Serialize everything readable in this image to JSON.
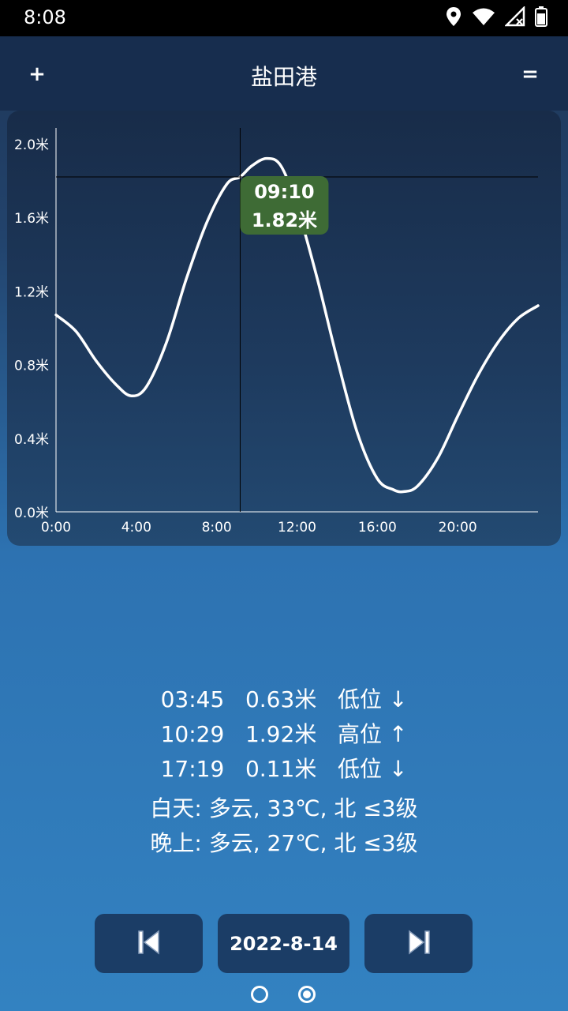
{
  "status_bar": {
    "time": "8:08",
    "icons": [
      "location-icon",
      "wifi-icon",
      "signal-off-icon",
      "battery-icon"
    ]
  },
  "app_bar": {
    "title": "盐田港",
    "add_label": "+",
    "menu_label": "="
  },
  "chart_data": {
    "type": "line",
    "x_tick_labels": [
      "0:00",
      "4:00",
      "8:00",
      "12:00",
      "16:00",
      "20:00"
    ],
    "y_tick_labels": [
      "0.0米",
      "0.4米",
      "0.8米",
      "1.2米",
      "1.6米",
      "2.0米"
    ],
    "xlim": [
      0,
      24
    ],
    "ylim": [
      0,
      2.0
    ],
    "x": [
      0,
      1,
      2,
      3,
      3.75,
      4.5,
      5.5,
      6.5,
      7.5,
      8.5,
      9.17,
      9.75,
      10.48,
      11.2,
      12,
      13,
      14,
      15,
      16,
      16.8,
      17.32,
      18,
      19,
      20,
      21,
      22,
      23,
      24
    ],
    "values": [
      1.07,
      0.98,
      0.82,
      0.69,
      0.63,
      0.68,
      0.92,
      1.27,
      1.57,
      1.78,
      1.82,
      1.88,
      1.92,
      1.88,
      1.66,
      1.27,
      0.83,
      0.43,
      0.18,
      0.12,
      0.11,
      0.14,
      0.29,
      0.52,
      0.74,
      0.92,
      1.05,
      1.12
    ],
    "crosshair": {
      "time": "09:10",
      "x": 9.17,
      "y": 1.82,
      "value_label": "1.82米"
    },
    "colors": {
      "line": "#ffffff",
      "tooltip": "#3e6b35",
      "highlight": "#7fd23a",
      "axis": "#ffffff",
      "crosshair": "#000000"
    },
    "grid": false
  },
  "tides": [
    {
      "time": "03:45",
      "height": "0.63米",
      "type": "低位",
      "arrow": "↓"
    },
    {
      "time": "10:29",
      "height": "1.92米",
      "type": "高位",
      "arrow": "↑"
    },
    {
      "time": "17:19",
      "height": "0.11米",
      "type": "低位",
      "arrow": "↓"
    }
  ],
  "weather": {
    "day": "白天: 多云, 33℃, 北 ≤3级",
    "night": "晚上: 多云, 27℃, 北 ≤3级"
  },
  "nav": {
    "date": "2022-8-14",
    "prev_icon": "skip-previous-icon",
    "next_icon": "skip-next-icon"
  },
  "pager": {
    "pages": 2,
    "active": 1
  }
}
